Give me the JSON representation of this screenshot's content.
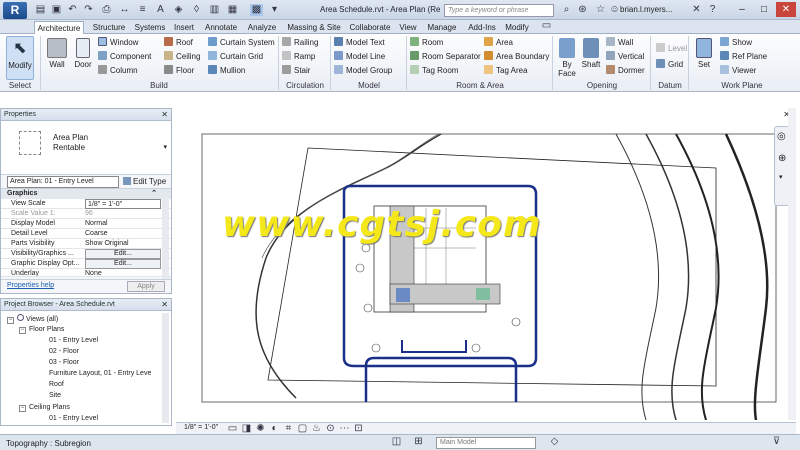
{
  "titlebar": {
    "logo": "R",
    "document_title": "Area Schedule.rvt - Area Plan (Re...",
    "search_placeholder": "Type a keyword or phrase",
    "user_name": "brian.l.myers..."
  },
  "tabs": [
    "Architecture",
    "Structure",
    "Systems",
    "Insert",
    "Annotate",
    "Analyze",
    "Massing & Site",
    "Collaborate",
    "View",
    "Manage",
    "Add-Ins",
    "Modify"
  ],
  "ribbon": {
    "select": {
      "modify": "Modify",
      "title": "Select"
    },
    "build": {
      "title": "Build",
      "wall": "Wall",
      "door": "Door",
      "window": "Window",
      "component": "Component",
      "column": "Column",
      "roof": "Roof",
      "ceiling": "Ceiling",
      "floor": "Floor",
      "curtain_system": "Curtain System",
      "curtain_grid": "Curtain Grid",
      "mullion": "Mullion"
    },
    "circulation": {
      "title": "Circulation",
      "railing": "Railing",
      "ramp": "Ramp",
      "stair": "Stair"
    },
    "model": {
      "title": "Model",
      "model_text": "Model Text",
      "model_line": "Model Line",
      "model_group": "Model Group"
    },
    "room_area": {
      "title": "Room & Area",
      "room": "Room",
      "room_separator": "Room Separator",
      "tag_room": "Tag Room",
      "area": "Area",
      "area_boundary": "Area Boundary",
      "tag_area": "Tag Area"
    },
    "opening": {
      "title": "Opening",
      "by_face": "By Face",
      "shaft": "Shaft",
      "wall": "Wall",
      "vertical": "Vertical",
      "dormer": "Dormer"
    },
    "datum": {
      "title": "Datum",
      "level": "Level",
      "grid": "Grid"
    },
    "work_plane": {
      "title": "Work Plane",
      "set": "Set",
      "show": "Show",
      "ref_plane": "Ref Plane",
      "viewer": "Viewer"
    }
  },
  "properties": {
    "header": "Properties",
    "type_name_line1": "Area Plan",
    "type_name_line2": "Rentable",
    "instance_selector": "Area Plan: 01 - Entry Level",
    "edit_type": "Edit Type",
    "group_graphics": "Graphics",
    "rows": [
      {
        "key": "View Scale",
        "value": "1/8\" = 1'-0\""
      },
      {
        "key": "Scale Value  1:",
        "value": "96"
      },
      {
        "key": "Display Model",
        "value": "Normal"
      },
      {
        "key": "Detail Level",
        "value": "Coarse"
      },
      {
        "key": "Parts Visibility",
        "value": "Show Original"
      },
      {
        "key": "Visibility/Graphics ...",
        "value": "Edit..."
      },
      {
        "key": "Graphic Display Opt...",
        "value": "Edit..."
      },
      {
        "key": "Underlay",
        "value": "None"
      }
    ],
    "help_link": "Properties help",
    "apply": "Apply"
  },
  "browser": {
    "header": "Project Browser - Area Schedule.rvt",
    "nodes": [
      "Views (all)",
      "Floor Plans",
      "01 - Entry Level",
      "02 - Floor",
      "03 - Floor",
      "Furniture Layout,  01 - Entry Leve",
      "Roof",
      "Site",
      "Ceiling Plans",
      "01 - Entry Level"
    ]
  },
  "view_control": {
    "scale": "1/8\" = 1'-0\""
  },
  "status": {
    "text": "Topography : Subregion",
    "model": "Main Model"
  },
  "watermark": "www.cgtsj.com"
}
